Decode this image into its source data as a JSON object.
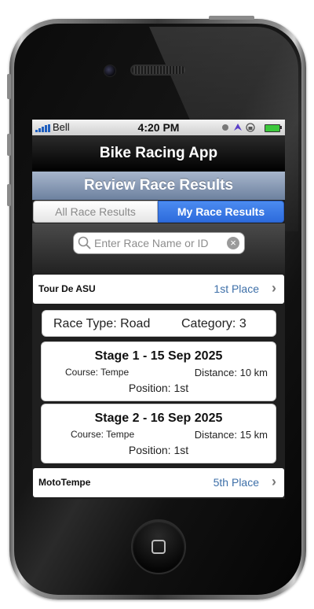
{
  "status_bar": {
    "carrier": "Bell",
    "time": "4:20 PM"
  },
  "app": {
    "title": "Bike Racing App",
    "section_title": "Review Race Results"
  },
  "segments": {
    "all": "All Race Results",
    "mine": "My Race Results",
    "selected": "mine"
  },
  "search": {
    "placeholder": "Enter Race Name or ID",
    "value": ""
  },
  "races": [
    {
      "name": "Tour De ASU",
      "place": "1st Place",
      "summary": {
        "race_type": "Race Type: Road",
        "category": "Category: 3"
      },
      "stages": [
        {
          "title": "Stage 1 - 15 Sep 2025",
          "course": "Course: Tempe",
          "distance": "Distance: 10 km",
          "position": "Position: 1st"
        },
        {
          "title": "Stage 2 - 16 Sep 2025",
          "course": "Course: Tempe",
          "distance": "Distance: 15 km",
          "position": "Position: 1st"
        }
      ]
    },
    {
      "name": "MotoTempe",
      "place": "5th Place"
    }
  ],
  "colors": {
    "segment_active": "#2d6bdc",
    "section_bar": "#8a9bb6",
    "place_text": "#3d6fa8"
  }
}
